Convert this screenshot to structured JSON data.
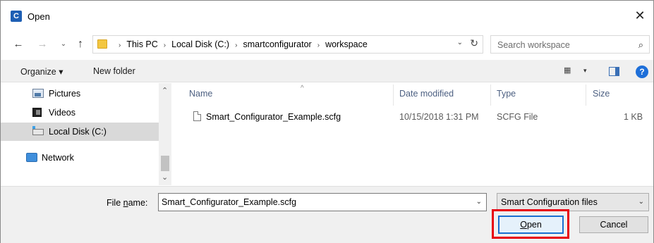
{
  "window": {
    "title": "Open",
    "close_glyph": "✕"
  },
  "nav": {
    "back_glyph": "←",
    "forward_glyph": "→",
    "recent_glyph": "⌄",
    "up_glyph": "↑",
    "breadcrumbs": [
      "This PC",
      "Local Disk (C:)",
      "smartconfigurator",
      "workspace"
    ],
    "separator": "›",
    "refresh_glyph": "↻",
    "dropdown_glyph": "⌄"
  },
  "search": {
    "placeholder": "Search workspace",
    "icon_glyph": "⌕"
  },
  "toolbar": {
    "organize_label": "Organize ▾",
    "new_folder_label": "New folder",
    "view_glyph": "▦",
    "view_dd_glyph": "▾",
    "help_glyph": "?"
  },
  "sidebar": {
    "items": [
      {
        "label": "Pictures",
        "icon": "pictures-icon"
      },
      {
        "label": "Videos",
        "icon": "videos-icon"
      },
      {
        "label": "Local Disk (C:)",
        "icon": "local-disk-icon",
        "selected": true
      },
      {
        "label": "Network",
        "icon": "network-icon"
      }
    ],
    "scroll_up_glyph": "⌃",
    "scroll_down_glyph": "⌄"
  },
  "filelist": {
    "columns": {
      "name": "Name",
      "date": "Date modified",
      "type": "Type",
      "size": "Size"
    },
    "sort_glyph": "^",
    "rows": [
      {
        "name": "Smart_Configurator_Example.scfg",
        "date": "10/15/2018 1:31 PM",
        "type": "SCFG File",
        "size": "1 KB"
      }
    ]
  },
  "footer": {
    "file_name_label_prefix": "File ",
    "file_name_label_accel": "n",
    "file_name_label_suffix": "ame:",
    "file_name_value": "Smart_Configurator_Example.scfg",
    "file_type_value": "Smart Configuration files",
    "dropdown_glyph": "⌄",
    "open_accel": "O",
    "open_rest": "pen",
    "cancel_label": "Cancel"
  },
  "colors": {
    "highlight": "#e8000f",
    "accent": "#1a6fd0"
  }
}
